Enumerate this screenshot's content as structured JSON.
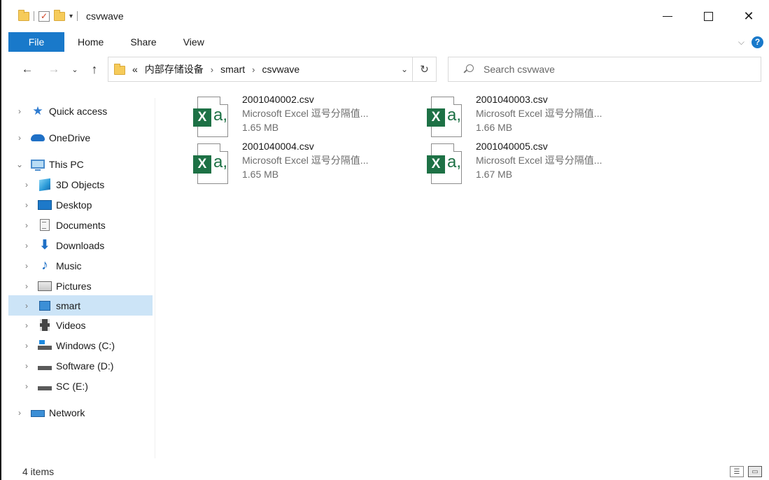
{
  "window": {
    "title": "csvwave",
    "controls": {
      "minimize": "",
      "maximize": "",
      "close": "✕"
    }
  },
  "ribbon": {
    "tabs": [
      "File",
      "Home",
      "Share",
      "View"
    ],
    "help": "?"
  },
  "address": {
    "overflow": "«",
    "parts": [
      "内部存储设备",
      "smart",
      "csvwave"
    ],
    "separator": "›"
  },
  "search": {
    "placeholder": "Search csvwave"
  },
  "sidebar": {
    "items": [
      {
        "label": "Quick access",
        "icon": "star-icon"
      },
      {
        "label": "OneDrive",
        "icon": "cloud-icon"
      },
      {
        "label": "This PC",
        "icon": "computer-icon"
      },
      {
        "label": "3D Objects",
        "icon": "cube-icon"
      },
      {
        "label": "Desktop",
        "icon": "desktop-icon"
      },
      {
        "label": "Documents",
        "icon": "documents-icon"
      },
      {
        "label": "Downloads",
        "icon": "download-icon"
      },
      {
        "label": "Music",
        "icon": "music-icon"
      },
      {
        "label": "Pictures",
        "icon": "pictures-icon"
      },
      {
        "label": "smart",
        "icon": "network-drive-icon",
        "selected": true
      },
      {
        "label": "Videos",
        "icon": "videos-icon"
      },
      {
        "label": "Windows (C:)",
        "icon": "windows-drive-icon"
      },
      {
        "label": "Software (D:)",
        "icon": "drive-icon"
      },
      {
        "label": "SC (E:)",
        "icon": "drive-icon"
      },
      {
        "label": "Network",
        "icon": "network-icon"
      }
    ]
  },
  "files": [
    {
      "name": "2001040002.csv",
      "type": "Microsoft Excel 逗号分隔值...",
      "size": "1.65 MB"
    },
    {
      "name": "2001040003.csv",
      "type": "Microsoft Excel 逗号分隔值...",
      "size": "1.66 MB"
    },
    {
      "name": "2001040004.csv",
      "type": "Microsoft Excel 逗号分隔值...",
      "size": "1.65 MB"
    },
    {
      "name": "2001040005.csv",
      "type": "Microsoft Excel 逗号分隔值...",
      "size": "1.67 MB"
    }
  ],
  "status": {
    "count": "4 items"
  },
  "icons": {
    "excel_letter": "X",
    "excel_a": "a,"
  },
  "colors": {
    "accent": "#1979ca",
    "excel_green": "#1d7145",
    "selection": "#cce4f7"
  }
}
